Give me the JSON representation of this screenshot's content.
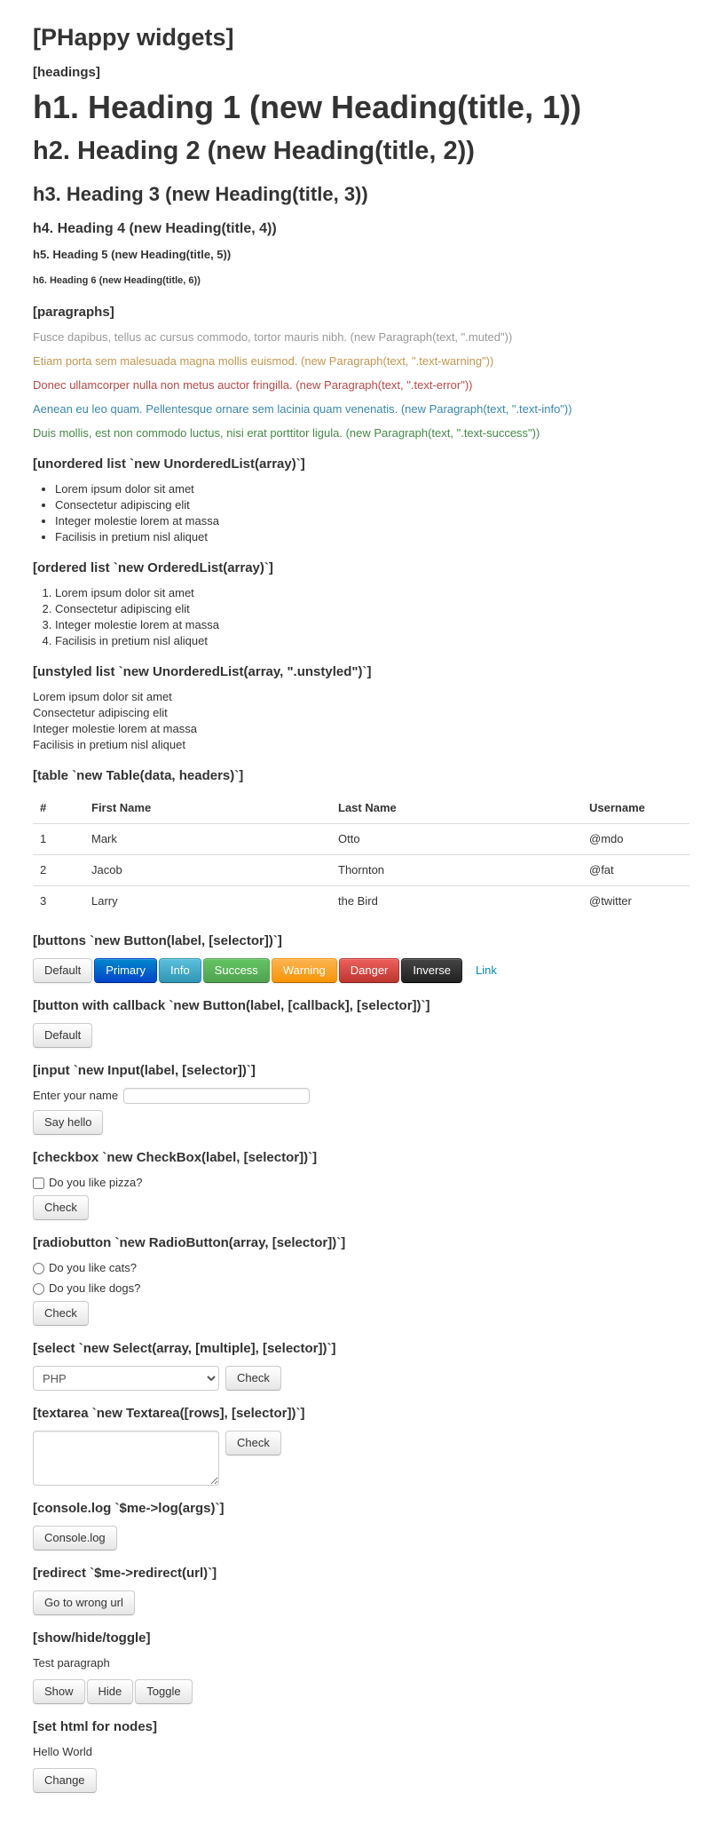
{
  "page": {
    "title": "[PHappy widgets]"
  },
  "sections": {
    "headings_title": "[headings]",
    "paragraphs_title": "[paragraphs]",
    "unordered_title": "[unordered list `new UnorderedList(array)`]",
    "ordered_title": "[ordered list `new OrderedList(array)`]",
    "unstyled_title": "[unstyled list `new UnorderedList(array, \".unstyled\")`]",
    "table_title": "[table `new Table(data, headers)`]",
    "buttons_title": "[buttons `new Button(label, [selector])`]",
    "button_callback_title": "[button with callback `new Button(label, [callback], [selector])`]",
    "input_title": "[input `new Input(label, [selector])`]",
    "checkbox_title": "[checkbox `new CheckBox(label, [selector])`]",
    "radio_title": "[radiobutton `new RadioButton(array, [selector])`]",
    "select_title": "[select `new Select(array, [multiple], [selector])`]",
    "textarea_title": "[textarea `new Textarea([rows], [selector])`]",
    "console_title": "[console.log `$me->log(args)`]",
    "redirect_title": "[redirect `$me->redirect(url)`]",
    "toggle_title": "[show/hide/toggle]",
    "sethtml_title": "[set html for nodes]"
  },
  "headings": {
    "h1": "h1. Heading 1 (new Heading(title, 1))",
    "h2": "h2. Heading 2 (new Heading(title, 2))",
    "h3": "h3. Heading 3 (new Heading(title, 3))",
    "h4": "h4. Heading 4 (new Heading(title, 4))",
    "h5": "h5. Heading 5 (new Heading(title, 5))",
    "h6": "h6. Heading 6 (new Heading(title, 6))"
  },
  "paragraphs": [
    {
      "text": "Fusce dapibus, tellus ac cursus commodo, tortor mauris nibh. (new Paragraph(text, \".muted\"))",
      "cls": "muted",
      "color": "#999999"
    },
    {
      "text": "Etiam porta sem malesuada magna mollis euismod. (new Paragraph(text, \".text-warning\"))",
      "cls": "text-warning",
      "color": "#c09853"
    },
    {
      "text": "Donec ullamcorper nulla non metus auctor fringilla. (new Paragraph(text, \".text-error\"))",
      "cls": "text-error",
      "color": "#b94a48"
    },
    {
      "text": "Aenean eu leo quam. Pellentesque ornare sem lacinia quam venenatis. (new Paragraph(text, \".text-info\"))",
      "cls": "text-info",
      "color": "#3a87ad"
    },
    {
      "text": "Duis mollis, est non commodo luctus, nisi erat porttitor ligula. (new Paragraph(text, \".text-success\"))",
      "cls": "text-success",
      "color": "#468847"
    }
  ],
  "unordered_items": [
    "Lorem ipsum dolor sit amet",
    "Consectetur adipiscing elit",
    "Integer molestie lorem at massa",
    "Facilisis in pretium nisl aliquet"
  ],
  "ordered_items": [
    "Lorem ipsum dolor sit amet",
    "Consectetur adipiscing elit",
    "Integer molestie lorem at massa",
    "Facilisis in pretium nisl aliquet"
  ],
  "unstyled_items": [
    "Lorem ipsum dolor sit amet",
    "Consectetur adipiscing elit",
    "Integer molestie lorem at massa",
    "Facilisis in pretium nisl aliquet"
  ],
  "table": {
    "headers": [
      "#",
      "First Name",
      "Last Name",
      "Username"
    ],
    "rows": [
      [
        "1",
        "Mark",
        "Otto",
        "@mdo"
      ],
      [
        "2",
        "Jacob",
        "Thornton",
        "@fat"
      ],
      [
        "3",
        "Larry",
        "the Bird",
        "@twitter"
      ]
    ]
  },
  "buttons": [
    {
      "label": "Default",
      "style": "btn",
      "color": "#f5f5f5"
    },
    {
      "label": "Primary",
      "style": "btn btn-primary",
      "color": "#006dcc"
    },
    {
      "label": "Info",
      "style": "btn btn-info",
      "color": "#49afcd"
    },
    {
      "label": "Success",
      "style": "btn btn-success",
      "color": "#5bb75b"
    },
    {
      "label": "Warning",
      "style": "btn btn-warning",
      "color": "#faa732"
    },
    {
      "label": "Danger",
      "style": "btn btn-danger",
      "color": "#da4f49"
    },
    {
      "label": "Inverse",
      "style": "btn btn-inverse",
      "color": "#363636"
    },
    {
      "label": "Link",
      "style": "btn btn-link",
      "color": "#0088cc"
    }
  ],
  "callback_button": {
    "label": "Default"
  },
  "input": {
    "label": "Enter your name",
    "value": "",
    "placeholder": "",
    "button_label": "Say hello"
  },
  "checkbox": {
    "label": "Do you like pizza?",
    "checked": false,
    "button_label": "Check"
  },
  "radio": {
    "options": [
      {
        "label": "Do you like cats?",
        "checked": false
      },
      {
        "label": "Do you like dogs?",
        "checked": false
      }
    ],
    "button_label": "Check"
  },
  "select": {
    "selected": "PHP",
    "options": [
      "PHP"
    ],
    "button_label": "Check"
  },
  "textarea": {
    "value": "",
    "button_label": "Check"
  },
  "console": {
    "button_label": "Console.log"
  },
  "redirect": {
    "button_label": "Go to wrong url"
  },
  "toggle": {
    "paragraph": "Test paragraph",
    "show_label": "Show",
    "hide_label": "Hide",
    "toggle_label": "Toggle"
  },
  "sethtml": {
    "paragraph": "Hello World",
    "button_label": "Change"
  }
}
